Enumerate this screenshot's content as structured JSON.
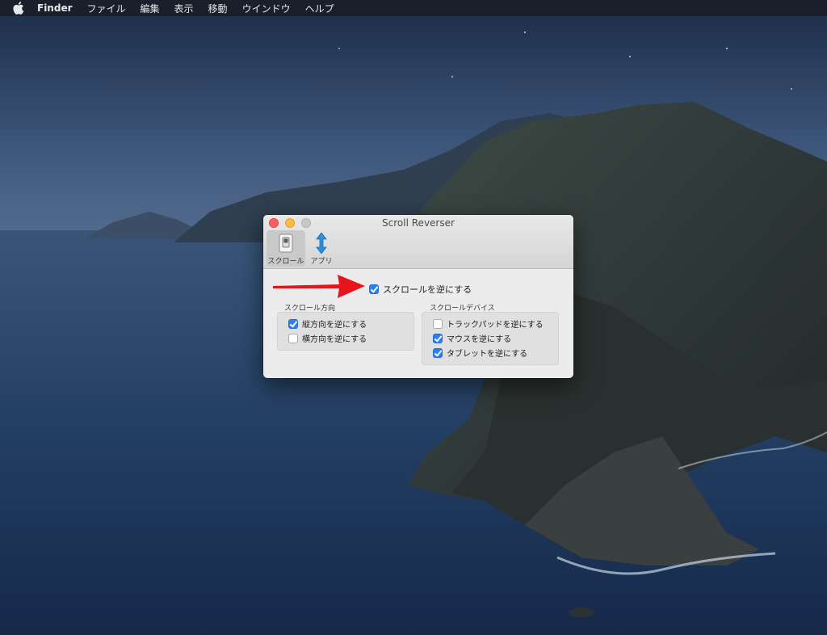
{
  "menubar": {
    "app_name": "Finder",
    "items": [
      "ファイル",
      "編集",
      "表示",
      "移動",
      "ウインドウ",
      "ヘルプ"
    ]
  },
  "window": {
    "title": "Scroll Reverser",
    "toolbar": [
      {
        "label": "スクロール",
        "icon": "switch-icon",
        "selected": true
      },
      {
        "label": "アプリ",
        "icon": "updown-arrows-icon",
        "selected": false
      }
    ],
    "main_checkbox": {
      "label": "スクロールを逆にする",
      "checked": true
    },
    "direction_group": {
      "label": "スクロール方向",
      "options": [
        {
          "label": "縦方向を逆にする",
          "checked": true
        },
        {
          "label": "横方向を逆にする",
          "checked": false
        }
      ]
    },
    "device_group": {
      "label": "スクロールデバイス",
      "options": [
        {
          "label": "トラックパッドを逆にする",
          "checked": false
        },
        {
          "label": "マウスを逆にする",
          "checked": true
        },
        {
          "label": "タブレットを逆にする",
          "checked": true
        }
      ]
    }
  },
  "colors": {
    "accent": "#2c7ef5",
    "annotation_arrow": "#e8141b"
  }
}
